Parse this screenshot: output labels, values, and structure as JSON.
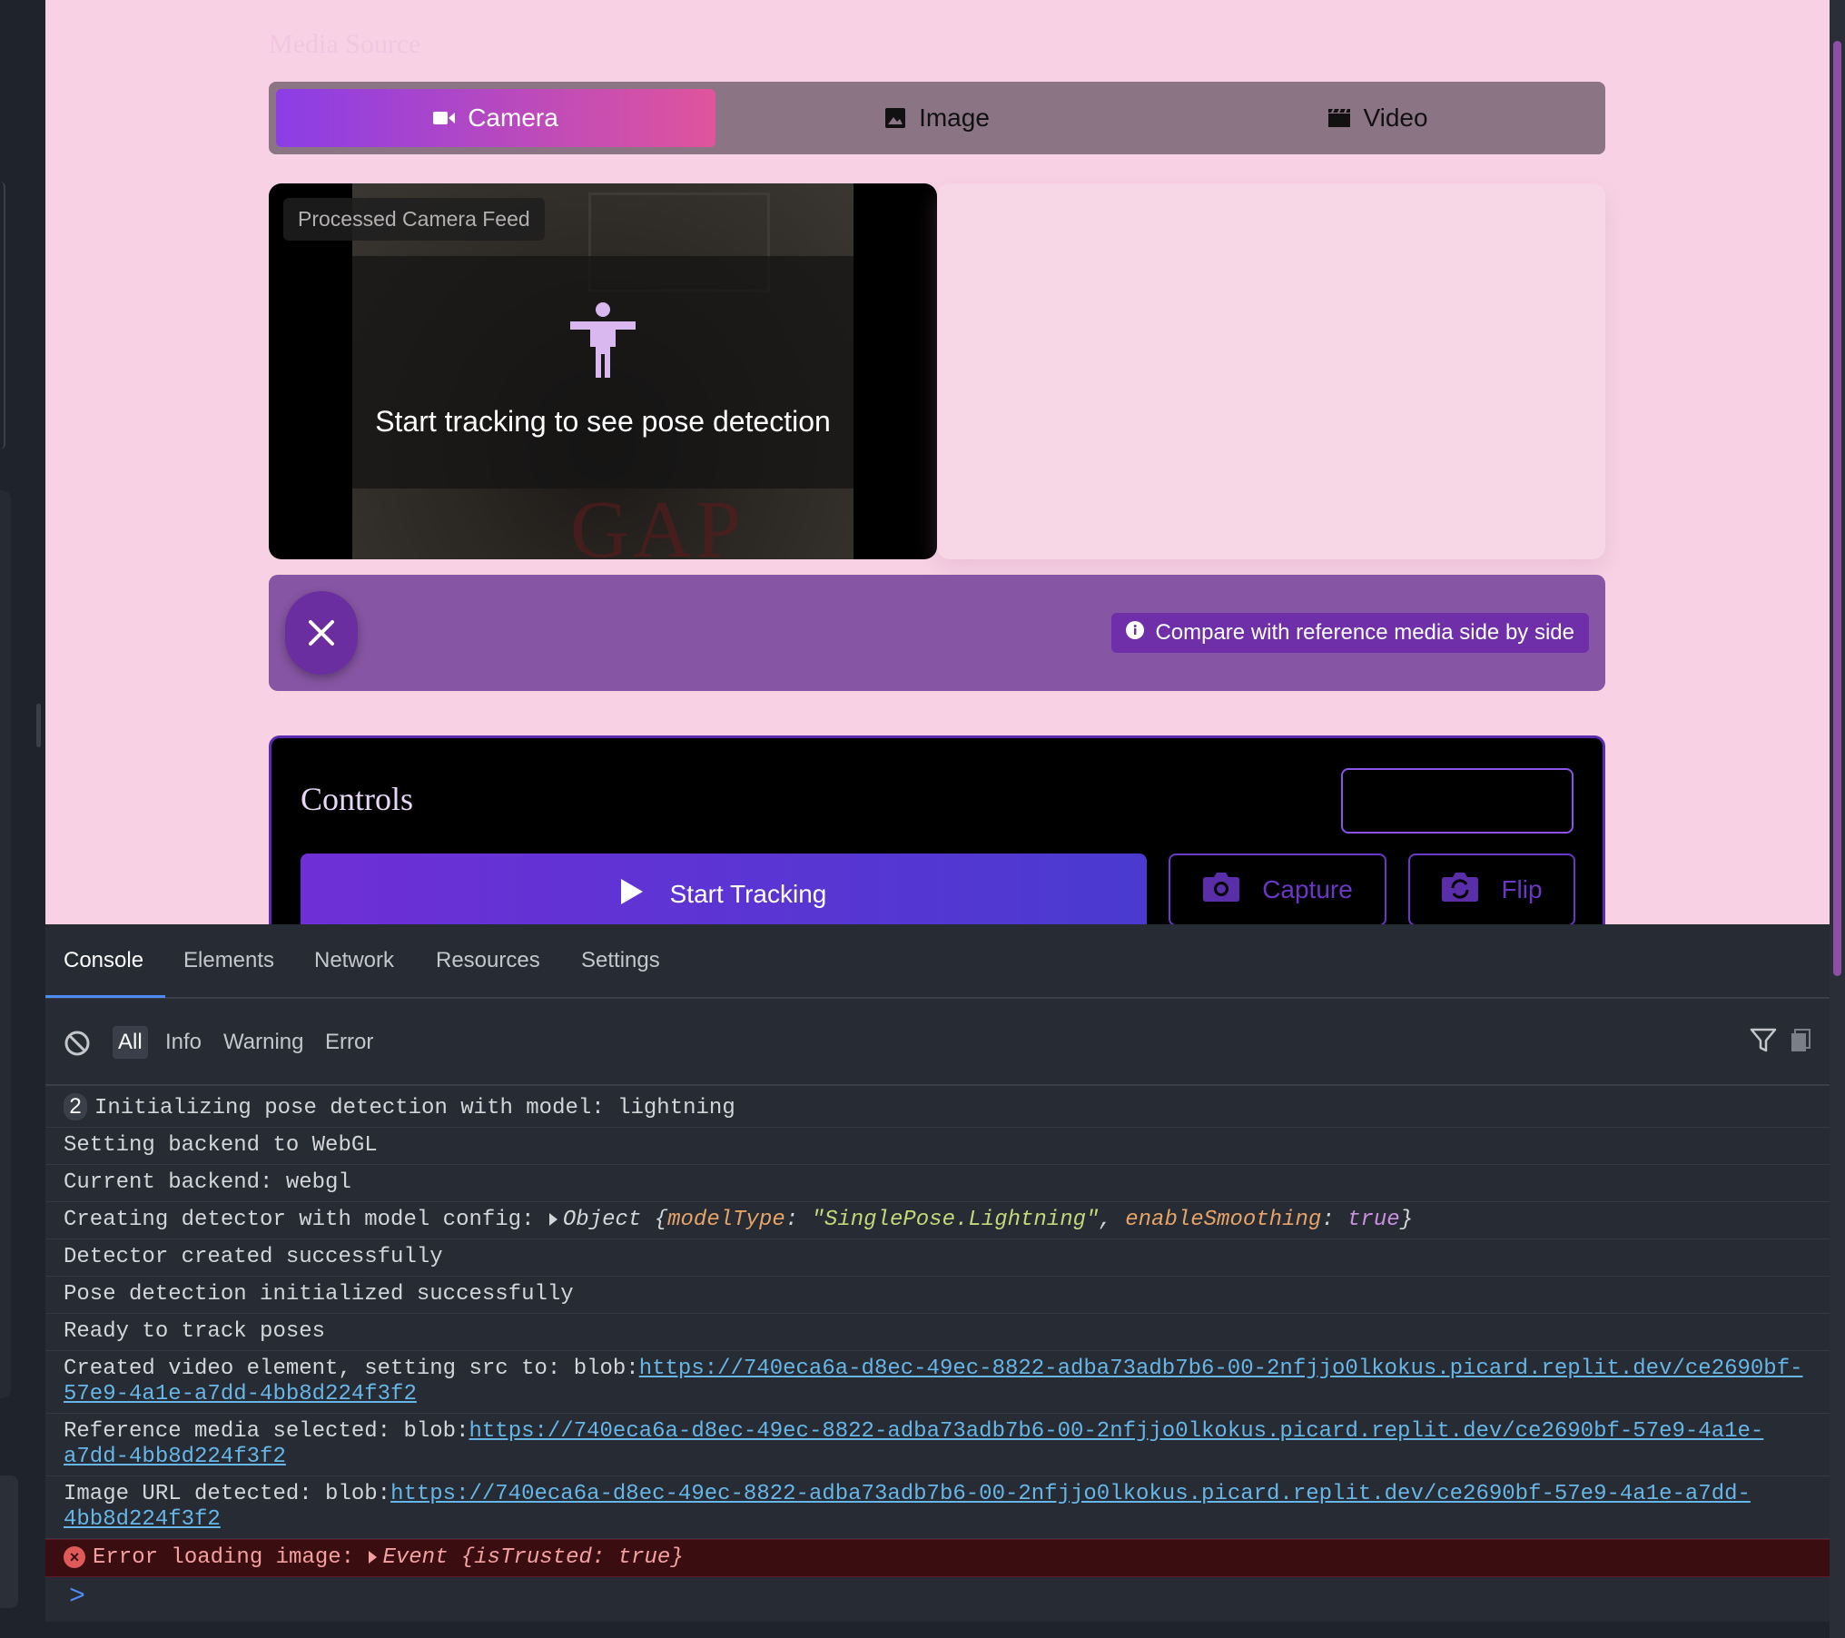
{
  "app": {
    "section_title": "Media Source",
    "tabs": [
      {
        "label": "Camera",
        "icon": "video-camera-icon",
        "active": true
      },
      {
        "label": "Image",
        "icon": "image-icon",
        "active": false
      },
      {
        "label": "Video",
        "icon": "film-icon",
        "active": false
      }
    ],
    "feed": {
      "badge": "Processed Camera Feed",
      "message": "Start tracking to see pose detection"
    },
    "banner": {
      "info": "Compare with reference media side by side"
    },
    "controls": {
      "title": "Controls",
      "start_label": "Start Tracking",
      "capture_label": "Capture",
      "flip_label": "Flip"
    },
    "colors": {
      "page_bg": "#f8d2e4",
      "accent_purple": "#8b3de6",
      "accent_pink": "#e0549c",
      "banner": "#8655a3"
    }
  },
  "devtools": {
    "tabs": [
      "Console",
      "Elements",
      "Network",
      "Resources",
      "Settings"
    ],
    "active_tab": "Console",
    "filters": [
      "All",
      "Info",
      "Warning",
      "Error"
    ],
    "active_filter": "All",
    "logs": {
      "l1_count": "2",
      "l1": "Initializing pose detection with model: lightning",
      "l2": "Setting backend to WebGL",
      "l3": "Current backend: webgl",
      "l4_prefix": "Creating detector with model config: ",
      "l4_obj": "Object",
      "l4_k1": "modelType",
      "l4_v1": "\"SinglePose.Lightning\"",
      "l4_k2": "enableSmoothing",
      "l4_v2": "true",
      "l5": "Detector created successfully",
      "l6": "Pose detection initialized successfully",
      "l7": "Ready to track poses",
      "l8_prefix": "Created video element, setting src to: blob:",
      "l8_url": "https://740eca6a-d8ec-49ec-8822-adba73adb7b6-00-2nfjjo0lkokus.picard.replit.dev/ce2690bf-57e9-4a1e-a7dd-4bb8d224f3f2",
      "l9_prefix": "Reference media selected: blob:",
      "l9_url": "https://740eca6a-d8ec-49ec-8822-adba73adb7b6-00-2nfjjo0lkokus.picard.replit.dev/ce2690bf-57e9-4a1e-a7dd-4bb8d224f3f2",
      "l10_prefix": "Image URL detected: blob:",
      "l10_url": "https://740eca6a-d8ec-49ec-8822-adba73adb7b6-00-2nfjjo0lkokus.picard.replit.dev/ce2690bf-57e9-4a1e-a7dd-4bb8d224f3f2",
      "err_prefix": "Error loading image: ",
      "err_obj": "Event {isTrusted: ",
      "err_val": "true",
      "err_close": "}"
    },
    "prompt": ">"
  }
}
